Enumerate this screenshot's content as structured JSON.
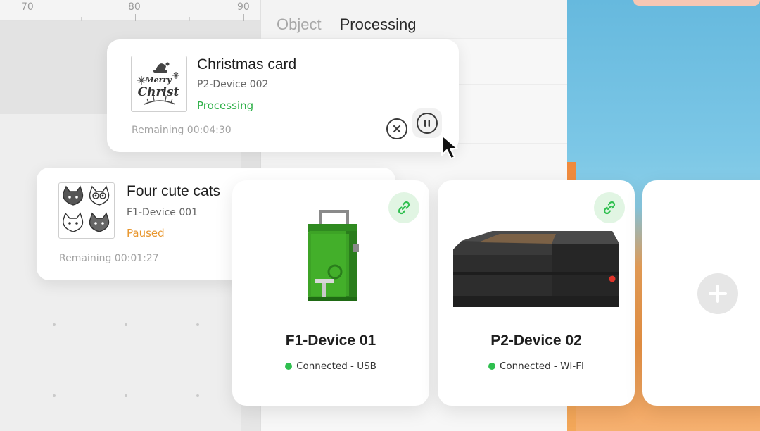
{
  "ruler": {
    "labels": [
      "70",
      "80",
      "90"
    ]
  },
  "panel": {
    "tabs": [
      "Object",
      "Processing"
    ],
    "active_tab": "Processing"
  },
  "jobs": [
    {
      "title": "Christmas card",
      "device": "P2-Device 002",
      "status": "Processing",
      "status_color": "#2fb049",
      "remaining": "Remaining 00:04:30",
      "thumb_icon": "merry-christmas-engraving"
    },
    {
      "title": "Four cute cats",
      "device": "F1-Device 001",
      "status": "Paused",
      "status_color": "#e8962e",
      "remaining": "Remaining 00:01:27",
      "thumb_icon": "four-cats-engraving"
    }
  ],
  "thumb_text": {
    "line1": "Merry",
    "line2": "Christ"
  },
  "devices": [
    {
      "name": "F1-Device 01",
      "connection": "Connected - USB",
      "image_icon": "green-f1-laser-engraver"
    },
    {
      "name": "P2-Device 02",
      "connection": "Connected - WI-FI",
      "image_icon": "dark-p2-laser-cutter"
    }
  ],
  "colors": {
    "accent_green": "#2fbf4f",
    "link_badge_bg": "#e1f5e3"
  }
}
